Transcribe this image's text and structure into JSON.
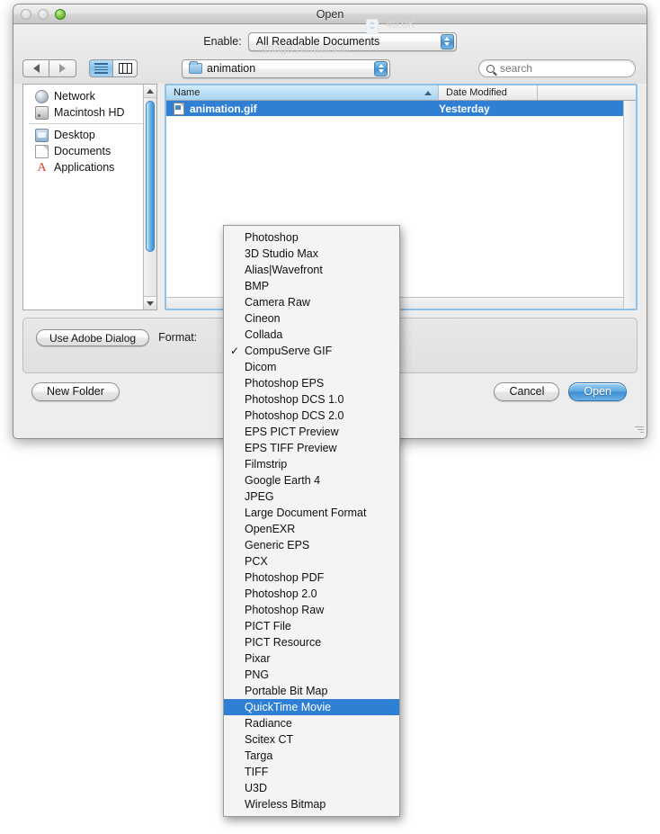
{
  "window": {
    "title": "Open",
    "traffic_lights": [
      "close-disabled",
      "minimize-disabled",
      "zoom-green"
    ]
  },
  "toolbar": {
    "enable_label": "Enable:",
    "enable_value": "All Readable Documents",
    "back_icon": "back-arrow-icon",
    "forward_icon": "forward-arrow-icon",
    "view_list_icon": "list-view-icon",
    "view_column_icon": "column-view-icon",
    "path_value": "animation",
    "path_icon": "folder-icon",
    "search_placeholder": "search",
    "search_value": "",
    "search_icon": "magnifier-icon"
  },
  "sidebar": {
    "groups": [
      {
        "items": [
          {
            "label": "Network",
            "icon": "network-globe-icon"
          },
          {
            "label": "Macintosh HD",
            "icon": "hard-disk-icon"
          }
        ]
      },
      {
        "items": [
          {
            "label": "Desktop",
            "icon": "desktop-icon"
          },
          {
            "label": "Documents",
            "icon": "document-icon"
          },
          {
            "label": "Applications",
            "icon": "applications-icon"
          }
        ]
      }
    ]
  },
  "file_list": {
    "columns": [
      "Name",
      "Date Modified",
      ""
    ],
    "sort_column": "Name",
    "sort_direction": "ascending",
    "rows": [
      {
        "name": "animation.gif",
        "date_modified": "Yesterday",
        "selected": true,
        "icon": "gif-file-icon"
      }
    ]
  },
  "options_panel": {
    "use_adobe_dialog_label": "Use Adobe Dialog",
    "format_label": "Format:",
    "ghost_size": "40.0K",
    "ghost_checkbox": "Image Sequence"
  },
  "buttons": {
    "new_folder": "New Folder",
    "cancel": "Cancel",
    "open": "Open"
  },
  "format_menu": {
    "selected": "CompuServe GIF",
    "highlighted": "QuickTime Movie",
    "items": [
      "Photoshop",
      "3D Studio Max",
      "Alias|Wavefront",
      "BMP",
      "Camera Raw",
      "Cineon",
      "Collada",
      "CompuServe GIF",
      "Dicom",
      "Photoshop EPS",
      "Photoshop DCS 1.0",
      "Photoshop DCS 2.0",
      "EPS PICT Preview",
      "EPS TIFF Preview",
      "Filmstrip",
      "Google Earth 4",
      "JPEG",
      "Large Document Format",
      "OpenEXR",
      "Generic EPS",
      "PCX",
      "Photoshop PDF",
      "Photoshop 2.0",
      "Photoshop Raw",
      "PICT File",
      "PICT Resource",
      "Pixar",
      "PNG",
      "Portable Bit Map",
      "QuickTime Movie",
      "Radiance",
      "Scitex CT",
      "Targa",
      "TIFF",
      "U3D",
      "Wireless Bitmap"
    ]
  },
  "colors": {
    "selection_blue": "#2f7fd4",
    "accent_header": "#a7d4f2",
    "window_bg": "#ededed"
  }
}
